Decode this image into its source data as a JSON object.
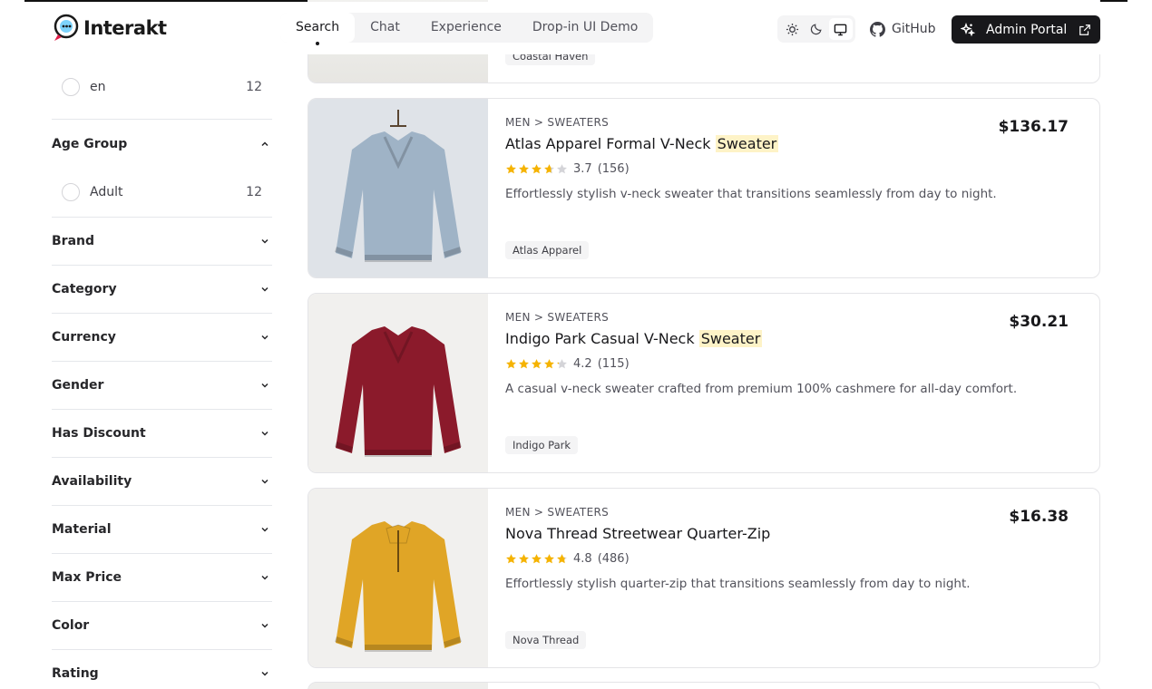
{
  "header": {
    "logo_text": "Interakt",
    "nav": [
      {
        "label": "Search",
        "active": true
      },
      {
        "label": "Chat",
        "active": false
      },
      {
        "label": "Experience",
        "active": false
      },
      {
        "label": "Drop-in UI Demo",
        "active": false
      }
    ],
    "theme_options": [
      "sun-icon",
      "moon-icon",
      "monitor-icon"
    ],
    "github_label": "GitHub",
    "admin_label": "Admin Portal"
  },
  "sidebar": {
    "language_option": {
      "label": "en",
      "count": "12"
    },
    "age_group": {
      "label": "Age Group",
      "option": {
        "label": "Adult",
        "count": "12"
      }
    },
    "facets": [
      "Brand",
      "Category",
      "Currency",
      "Gender",
      "Has Discount",
      "Availability",
      "Material",
      "Max Price",
      "Color",
      "Rating"
    ]
  },
  "partial_top_card": {
    "brand": "Coastal Haven"
  },
  "products": [
    {
      "breadcrumb": "MEN > SWEATERS",
      "title_main": "Atlas Apparel Formal V-Neck",
      "title_highlight": "Sweater",
      "price": "$136.17",
      "rating": "3.7",
      "reviews": "(156)",
      "rating_value": 3.7,
      "description": "Effortlessly stylish v-neck sweater that transitions seamlessly from day to night.",
      "brand": "Atlas Apparel",
      "color": "#9fb3c6"
    },
    {
      "breadcrumb": "MEN > SWEATERS",
      "title_main": "Indigo Park Casual V-Neck",
      "title_highlight": "Sweater",
      "price": "$30.21",
      "rating": "4.2",
      "reviews": "(115)",
      "rating_value": 4.2,
      "description": "A casual v-neck sweater crafted from premium 100% cashmere for all-day comfort.",
      "brand": "Indigo Park",
      "color": "#8b1a2b"
    },
    {
      "breadcrumb": "MEN > SWEATERS",
      "title_main": "Nova Thread Streetwear Quarter-Zip",
      "title_highlight": "",
      "price": "$16.38",
      "rating": "4.8",
      "reviews": "(486)",
      "rating_value": 4.8,
      "description": "Effortlessly stylish quarter-zip that transitions seamlessly from day to night.",
      "brand": "Nova Thread",
      "color": "#e0a526"
    }
  ],
  "colors": {
    "accent_dark": "#18181b",
    "highlight": "#fef3c7",
    "star": "#f5b301",
    "star_empty": "#d4d4d8"
  }
}
